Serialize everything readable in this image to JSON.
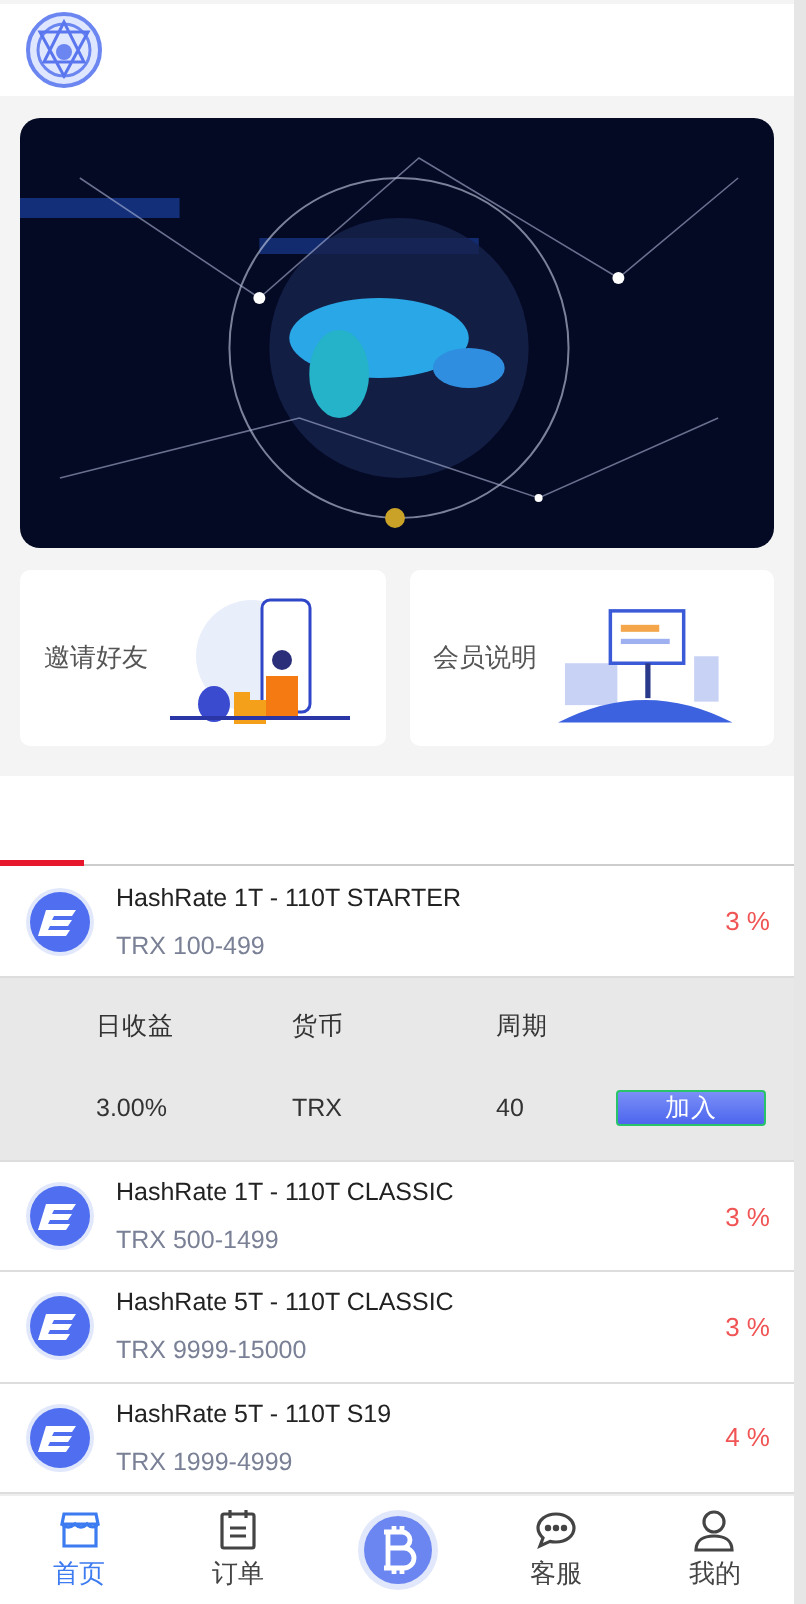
{
  "header": {
    "kind": "logo"
  },
  "cards": [
    {
      "label": "邀请好友"
    },
    {
      "label": "会员说明"
    }
  ],
  "plans": [
    {
      "name": "HashRate 1T - 110T STARTER",
      "range": "TRX 100-499",
      "rate": "3 %",
      "expanded": true,
      "details": {
        "headers": [
          "日收益",
          "货币",
          "周期"
        ],
        "values": [
          "3.00%",
          "TRX",
          "40"
        ],
        "button": "加入"
      }
    },
    {
      "name": "HashRate 1T - 110T CLASSIC",
      "range": "TRX 500-1499",
      "rate": "3 %",
      "expanded": false
    },
    {
      "name": "HashRate 5T - 110T CLASSIC",
      "range": "TRX 9999-15000",
      "rate": "3 %",
      "expanded": false
    },
    {
      "name": "HashRate 5T - 110T S19",
      "range": "TRX 1999-4999",
      "rate": "4 %",
      "expanded": false
    }
  ],
  "nav": [
    {
      "label": "首页",
      "kind": "home",
      "selected": true
    },
    {
      "label": "订单",
      "kind": "orders",
      "selected": false
    },
    {
      "kind": "center"
    },
    {
      "label": "客服",
      "kind": "chat",
      "selected": false
    },
    {
      "label": "我的",
      "kind": "profile",
      "selected": false
    }
  ]
}
